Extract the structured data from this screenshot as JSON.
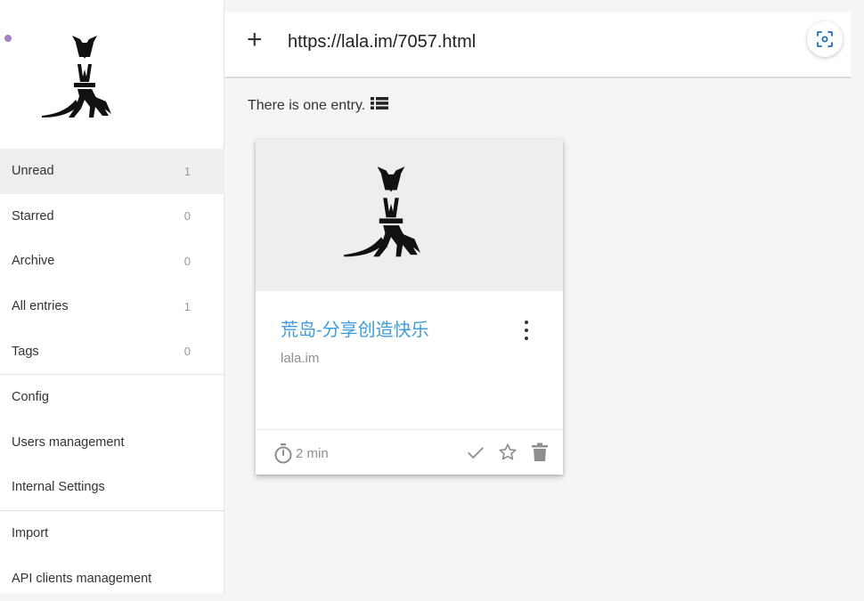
{
  "sidebar": {
    "items": [
      {
        "label": "Unread",
        "count": "1"
      },
      {
        "label": "Starred",
        "count": "0"
      },
      {
        "label": "Archive",
        "count": "0"
      },
      {
        "label": "All entries",
        "count": "1"
      },
      {
        "label": "Tags",
        "count": "0"
      },
      {
        "label": "Config"
      },
      {
        "label": "Users management"
      },
      {
        "label": "Internal Settings"
      },
      {
        "label": "Import"
      },
      {
        "label": "API clients management"
      }
    ]
  },
  "header": {
    "url_value": "https://lala.im/7057.html",
    "icons": {
      "add": "plus-icon",
      "scan": "qr-scan-icon"
    }
  },
  "main": {
    "entry_count_text": "There is one entry.",
    "entries": [
      {
        "title": "荒岛-分享创造快乐",
        "domain": "lala.im",
        "reading_time": "2 min"
      }
    ]
  },
  "colors": {
    "accent_link": "#3f9cdc",
    "dot": "#a57fc3",
    "active_bg": "#eeeeee"
  }
}
